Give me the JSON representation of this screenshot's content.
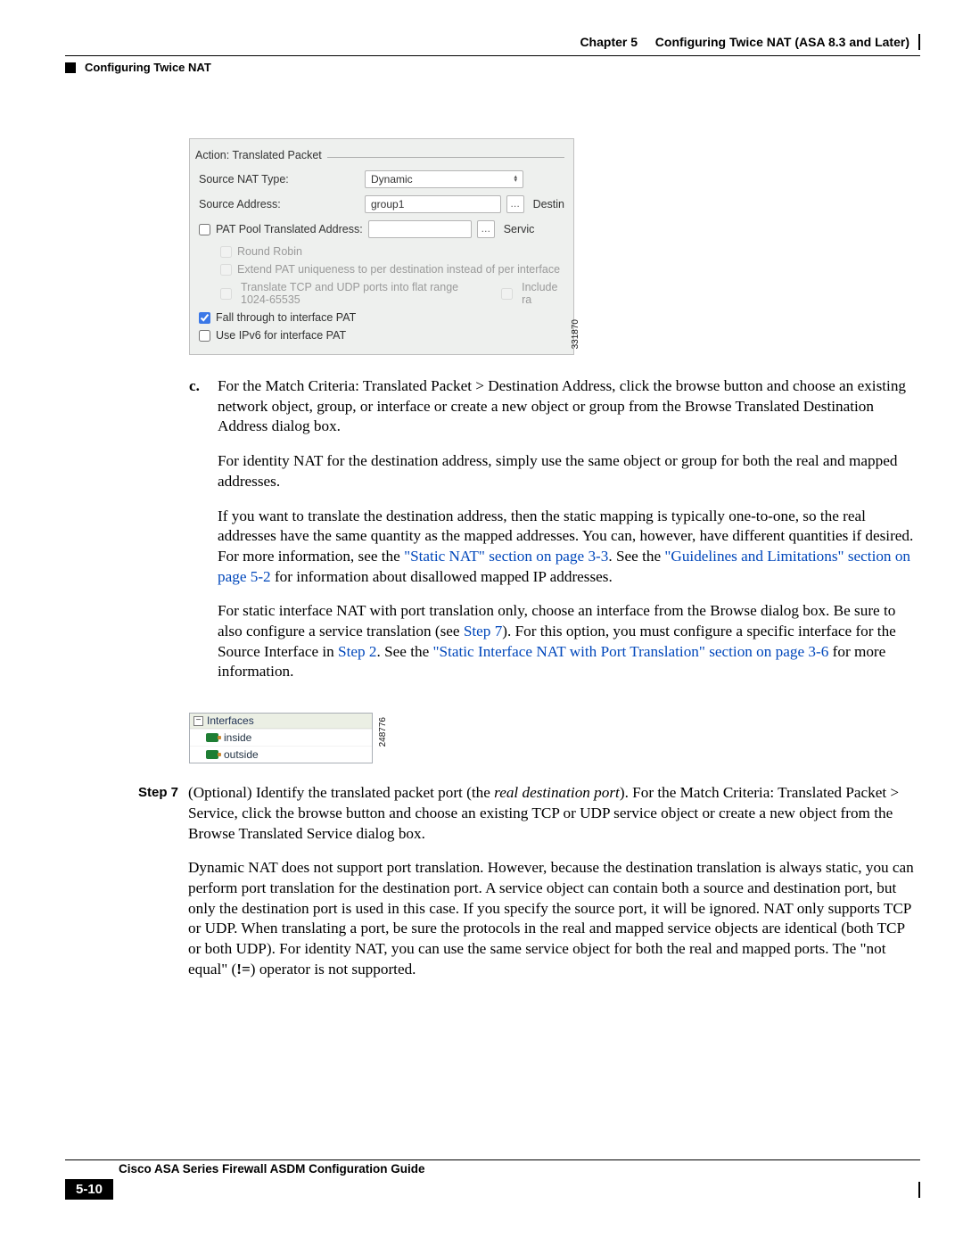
{
  "header": {
    "chapter": "Chapter 5",
    "chapter_title": "Configuring Twice NAT (ASA 8.3 and Later)",
    "section_title": "Configuring Twice NAT"
  },
  "shot1": {
    "legend": "Action: Translated Packet",
    "row1_label": "Source NAT Type:",
    "row1_value": "Dynamic",
    "row2_label": "Source Address:",
    "row2_value": "group1",
    "row2_rlabel": "Destin",
    "row3_label": "PAT Pool Translated Address:",
    "row3_value": "",
    "row3_rlabel": "Servic",
    "chk_rr": "Round Robin",
    "chk_ext": "Extend PAT uniqueness to per destination instead of per interface",
    "chk_flat": "Translate TCP and UDP ports into flat range 1024-65535",
    "chk_flat_inc": "Include ra",
    "chk_fall": "Fall through to interface PAT",
    "chk_ipv6": "Use IPv6 for interface PAT",
    "image_id": "331870"
  },
  "body": {
    "c_label": "c.",
    "c_p1_a": "For the Match Criteria: Translated Packet > Destination Address, click the browse button and choose an existing network object, group, or interface or create a new object or group from the Browse Translated Destination Address dialog box.",
    "c_p2": "For identity NAT for the destination address, simply use the same object or group for both the real and mapped addresses.",
    "c_p3_a": "If you want to translate the destination address, then the static mapping is typically one-to-one, so the real addresses have the same quantity as the mapped addresses. You can, however, have different quantities if desired. For more information, see the ",
    "c_p3_link1": "\"Static NAT\" section on page 3-3",
    "c_p3_b": ". See the ",
    "c_p3_link2": "\"Guidelines and Limitations\" section on page 5-2",
    "c_p3_c": " for information about disallowed mapped IP addresses.",
    "c_p4_a": "For static interface NAT with port translation only, choose an interface from the Browse dialog box. Be sure to also configure a service translation (see ",
    "c_p4_link1": "Step 7",
    "c_p4_b": "). For this option, you must configure a specific interface for the Source Interface in ",
    "c_p4_link2": "Step 2",
    "c_p4_c": ". See the ",
    "c_p4_link3": "\"Static Interface NAT with Port Translation\" section on page 3-6",
    "c_p4_d": " for more information."
  },
  "shot2": {
    "root": "Interfaces",
    "item1": "inside",
    "item2": "outside",
    "image_id": "248776"
  },
  "step7": {
    "label": "Step 7",
    "p1_a": "(Optional) Identify the translated packet port (the ",
    "p1_i": "real destination port",
    "p1_b": "). For the Match Criteria: Translated Packet > Service, click the browse button and choose an existing TCP or UDP service object or create a new object from the Browse Translated Service dialog box.",
    "p2": "Dynamic NAT does not support port translation. However, because the destination translation is always static, you can perform port translation for the destination port. A service object can contain both a source and destination port, but only the destination port is used in this case. If you specify the source port, it will be ignored. NAT only supports TCP or UDP. When translating a port, be sure the protocols in the real and mapped service objects are identical (both TCP or both UDP). For identity NAT, you can use the same service object for both the real and mapped ports. The \"not equal\" (",
    "p2_b": ") operator is not supported.",
    "p2_op": "!="
  },
  "footer": {
    "guide": "Cisco ASA Series Firewall ASDM Configuration Guide",
    "page": "5-10"
  }
}
